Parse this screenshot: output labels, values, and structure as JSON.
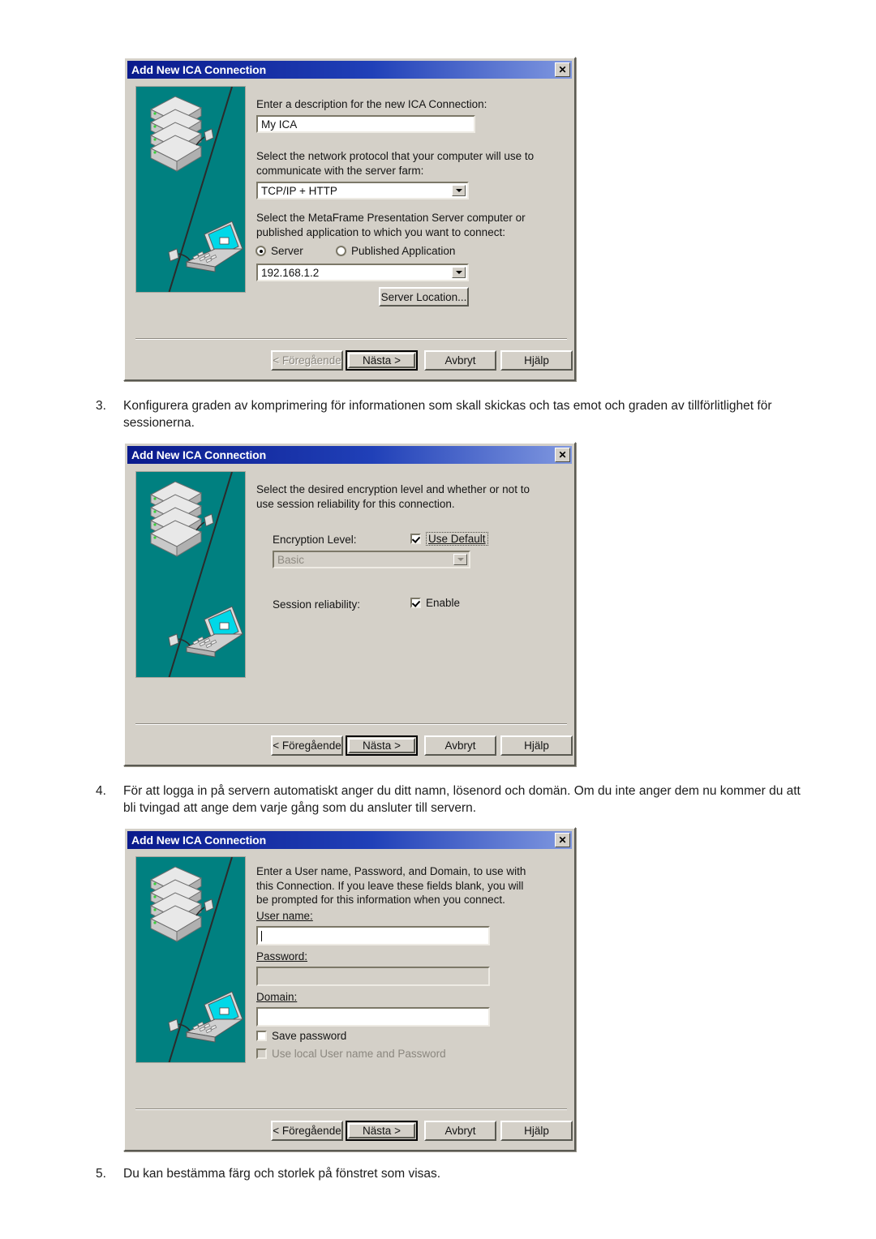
{
  "document": {
    "steps": [
      {
        "number": "3.",
        "text": "Konfigurera graden av komprimering för informationen som skall skickas och tas emot och graden av tillförlitlighet för sessionerna."
      },
      {
        "number": "4.",
        "text": "För att logga in på servern automatiskt anger du ditt namn, lösenord och domän. Om du inte anger dem nu kommer du att bli tvingad att ange dem varje gång som du ansluter till servern."
      },
      {
        "number": "5.",
        "text": "Du kan bestämma färg och storlek på fönstret som visas."
      }
    ]
  },
  "colors": {
    "dialog_face": "#d4d0c8",
    "titlebar_start": "#0a1a8c",
    "titlebar_end": "#8098e0",
    "illustration_bg": "#008080",
    "field_bg": "#ffffff",
    "disabled_text": "#8b877f"
  },
  "wizard_buttons": {
    "back": "< Föregående",
    "next": "Nästa >",
    "cancel": "Avbryt",
    "help": "Hjälp"
  },
  "dialog1": {
    "title": "Add New ICA Connection",
    "close_icon": "✕",
    "description_label": "Enter a description for the new ICA Connection:",
    "description_value": "My ICA",
    "protocol_label": "Select the network protocol that your computer will use to\ncommunicate with the server farm:",
    "protocol_value": "TCP/IP + HTTP",
    "target_label": "Select the MetaFrame Presentation Server computer or\npublished application to which you want to connect:",
    "radio_server": "Server",
    "radio_published_application": "Published Application",
    "server_value": "192.168.1.2",
    "server_location_button": "Server Location...",
    "back_disabled": true
  },
  "dialog2": {
    "title": "Add New ICA Connection",
    "close_icon": "✕",
    "intro": "Select the desired encryption level and whether or not to\nuse session reliability for this connection.",
    "encryption_label": "Encryption Level:",
    "use_default_label": "Use Default",
    "use_default_checked": true,
    "encryption_value": "Basic",
    "encryption_disabled": true,
    "session_reliability_label": "Session reliability:",
    "enable_label": "Enable",
    "enable_checked": true,
    "back_disabled": false
  },
  "dialog3": {
    "title": "Add New ICA Connection",
    "close_icon": "✕",
    "intro": "Enter a User name, Password, and Domain, to use with\nthis Connection.  If you leave these fields blank, you will\nbe prompted for this information when you connect.",
    "username_label": "User name:",
    "username_value": "",
    "password_label": "Password:",
    "password_value": "",
    "password_disabled": true,
    "domain_label": "Domain:",
    "domain_value": "",
    "save_password_label": "Save password",
    "save_password_checked": false,
    "use_local_label": "Use local User name and Password",
    "use_local_checked": false,
    "use_local_disabled": true,
    "back_disabled": false
  }
}
